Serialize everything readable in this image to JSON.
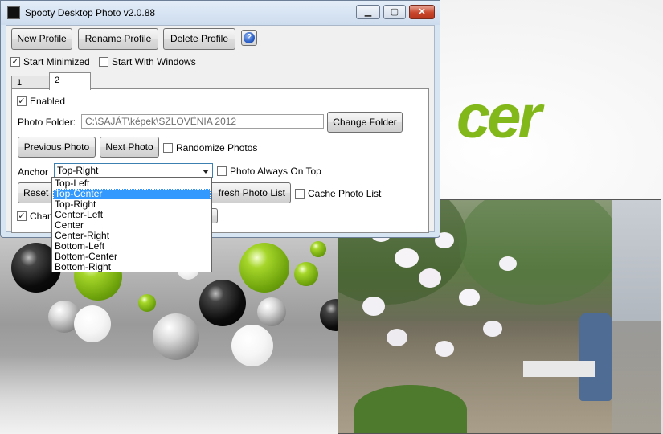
{
  "window": {
    "title": "Spooty Desktop Photo v2.0.88",
    "caption_buttons": {
      "minimize": "▁",
      "maximize": "▢",
      "close": "✕"
    }
  },
  "toolbar": {
    "new_profile": "New Profile",
    "rename_profile": "Rename Profile",
    "delete_profile": "Delete Profile",
    "help": "?"
  },
  "options": {
    "start_minimized": {
      "label": "Start Minimized",
      "checked": true
    },
    "start_with_windows": {
      "label": "Start With Windows",
      "checked": false
    }
  },
  "tabs": [
    {
      "label": "1"
    },
    {
      "label": "2",
      "active": true
    }
  ],
  "profile": {
    "enabled": {
      "label": "Enabled",
      "checked": true
    },
    "photo_folder_label": "Photo Folder:",
    "photo_folder_value": "C:\\SAJÁT\\képek\\SZLOVÉNIA 2012",
    "change_folder": "Change Folder",
    "previous_photo": "Previous Photo",
    "next_photo": "Next Photo",
    "randomize": {
      "label": "Randomize Photos",
      "checked": false
    },
    "anchor_label": "Anchor",
    "anchor_value": "Top-Right",
    "always_on_top": {
      "label": "Photo Always On Top",
      "checked": false
    },
    "reset_button": "Reset",
    "refresh_button": "fresh Photo List",
    "cache": {
      "label": "Cache Photo List",
      "checked": false
    },
    "change_label": "Chan",
    "check_mark": "✓"
  },
  "anchor_options": [
    "Top-Left",
    "Top-Center",
    "Top-Right",
    "Center-Left",
    "Center",
    "Center-Right",
    "Bottom-Left",
    "Bottom-Center",
    "Bottom-Right"
  ],
  "anchor_highlighted": "Top-Center",
  "desktop": {
    "logo_text": "cer",
    "accent_color": "#83b81a"
  }
}
